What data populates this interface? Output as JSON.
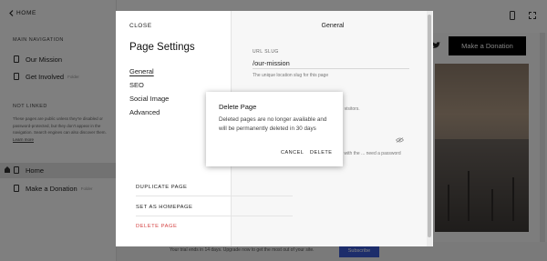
{
  "sidebar": {
    "home_label": "HOME",
    "main_nav_heading": "MAIN NAVIGATION",
    "main_nav_items": [
      {
        "label": "Our Mission",
        "tag": ""
      },
      {
        "label": "Get Involved",
        "tag": "Folder"
      }
    ],
    "not_linked_heading": "NOT LINKED",
    "not_linked_description": "These pages are public unless they're disabled or password-protected, but they don't appear in the navigation. Search engines can also discover them.",
    "learn_more": "Learn more",
    "not_linked_items": [
      {
        "label": "Home",
        "tag": ""
      },
      {
        "label": "Make a Donation",
        "tag": "Folder"
      }
    ]
  },
  "preview": {
    "donate_button": "Make a Donation",
    "footer_text": "Your trial ends in 14 days. Upgrade now to get the most out of your site.",
    "subscribe_button": "Subscribe"
  },
  "settings_panel": {
    "close_label": "CLOSE",
    "title": "Page Settings",
    "tabs": [
      "General",
      "SEO",
      "Social Image",
      "Advanced"
    ],
    "active_tab": "General",
    "section_title": "General",
    "url_slug_label": "URL SLUG",
    "url_slug_value": "/our-mission",
    "url_slug_description": "The unique location slug for this page",
    "visitors_text": "to site visitors.",
    "password_description": "Users with the ... need a password",
    "actions": {
      "duplicate": "DUPLICATE PAGE",
      "set_homepage": "SET AS HOMEPAGE",
      "delete": "DELETE PAGE"
    }
  },
  "dialog": {
    "title": "Delete Page",
    "body": "Deleted pages are no longer available and will be permanently deleted in 30 days",
    "cancel": "CANCEL",
    "delete": "DELETE"
  },
  "colors": {
    "accent_danger": "#d54545",
    "subscribe_blue": "#3b5bd6",
    "overlay": "rgba(0,0,0,0.5)"
  }
}
